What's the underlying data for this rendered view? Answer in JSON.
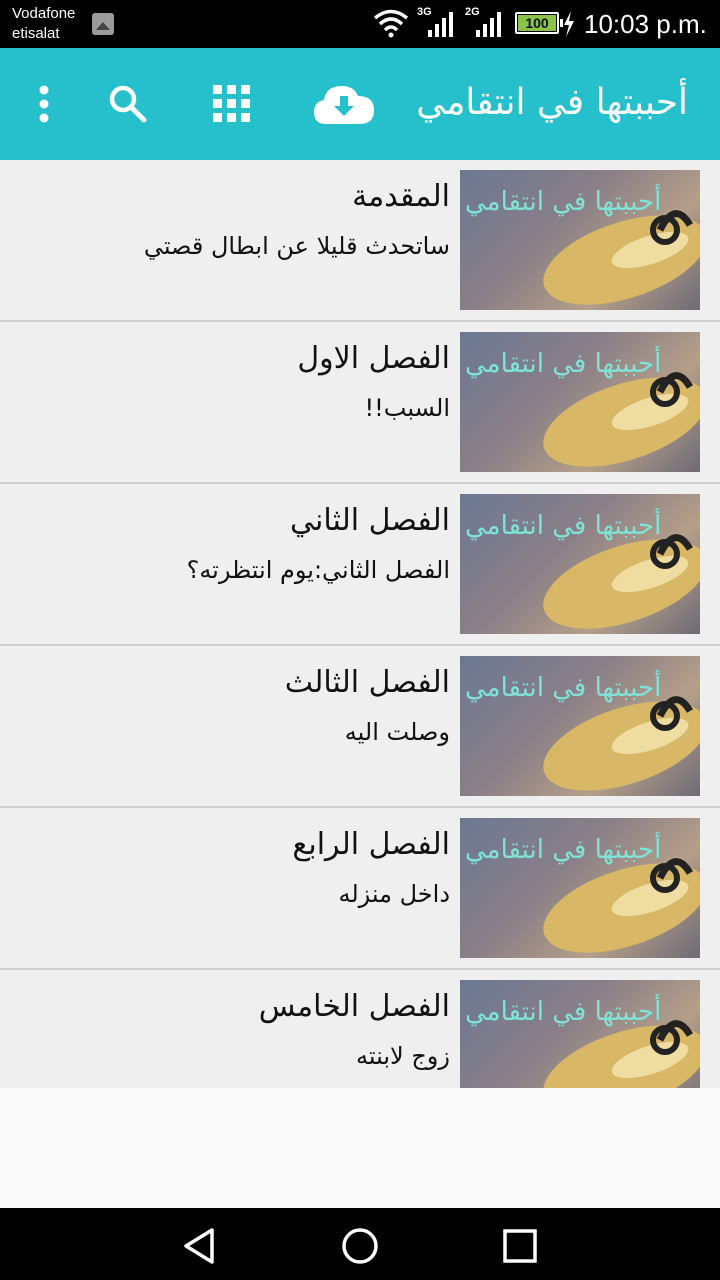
{
  "status_bar": {
    "carrier_line1": "Vodafone",
    "carrier_line2": "etisalat",
    "net1": "3G",
    "net2": "2G",
    "battery": "100",
    "time": "10:03 p.m."
  },
  "app_bar": {
    "title": "أحببتها في انتقامي",
    "icons": [
      "more-vert-icon",
      "search-icon",
      "apps-grid-icon",
      "cloud-download-icon"
    ],
    "color": "#26bfcc"
  },
  "chapters": [
    {
      "title": "المقدمة",
      "subtitle": "ساتحدث قليلا عن ابطال قصتي"
    },
    {
      "title": "الفصل الاول",
      "subtitle": "السبب!!"
    },
    {
      "title": "الفصل الثاني",
      "subtitle": "الفصل الثاني:يوم انتظرته؟"
    },
    {
      "title": "الفصل الثالث",
      "subtitle": "وصلت اليه"
    },
    {
      "title": "الفصل الرابع",
      "subtitle": "داخل منزله"
    },
    {
      "title": "الفصل الخامس",
      "subtitle": "زوج لابنته"
    }
  ],
  "thumbnail_caption": "أحببتها في انتقامي",
  "nav_bar": {
    "icons": [
      "back-icon",
      "home-icon",
      "recents-icon"
    ]
  }
}
